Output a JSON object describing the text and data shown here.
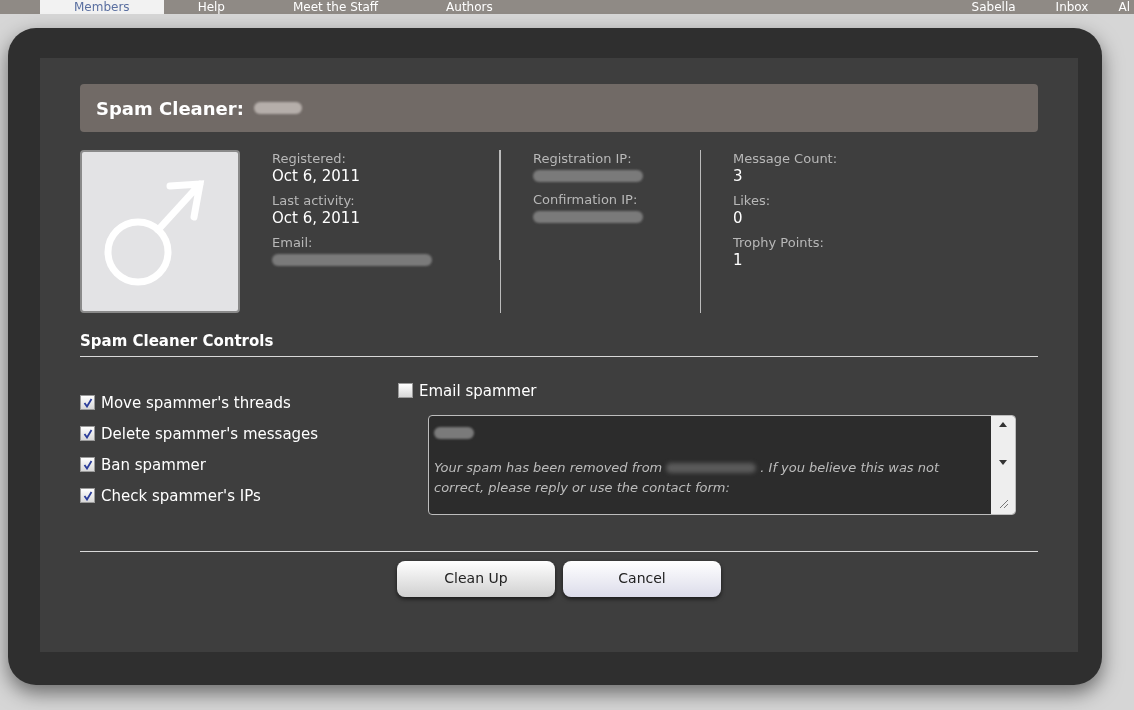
{
  "background_nav": {
    "items": [
      {
        "label": "Members",
        "selected": true
      },
      {
        "label": "Help",
        "selected": false
      },
      {
        "label": "Meet the Staff",
        "selected": false
      },
      {
        "label": "Authors",
        "selected": false
      }
    ],
    "user": "Sabella",
    "inbox": "Inbox",
    "cut_item": "Al"
  },
  "dialog": {
    "title": "Spam Cleaner:",
    "stats": [
      [
        {
          "label": "Registered:",
          "value": "Oct 6, 2011"
        },
        {
          "label": "Last activity:",
          "value": "Oct 6, 2011"
        },
        {
          "label": "Email:",
          "redacted": true
        }
      ],
      [
        {
          "label": "Registration IP:",
          "redacted": true
        },
        {
          "label": "Confirmation IP:",
          "redacted": true
        }
      ],
      [
        {
          "label": "Message Count:",
          "value": "3"
        },
        {
          "label": "Likes:",
          "value": "0"
        },
        {
          "label": "Trophy Points:",
          "value": "1"
        }
      ]
    ],
    "controls_heading": "Spam Cleaner Controls",
    "options": [
      {
        "label": "Move spammer's threads",
        "checked": true
      },
      {
        "label": "Delete spammer's messages",
        "checked": true
      },
      {
        "label": "Ban spammer",
        "checked": true
      },
      {
        "label": "Check spammer's IPs",
        "checked": true
      }
    ],
    "email_option": {
      "label": "Email spammer",
      "checked": false
    },
    "email_text": {
      "before": "Your spam has been removed from",
      "after": ". If you believe this was not correct, please reply or use the contact form:"
    },
    "buttons": [
      "Clean Up",
      "Cancel"
    ]
  }
}
